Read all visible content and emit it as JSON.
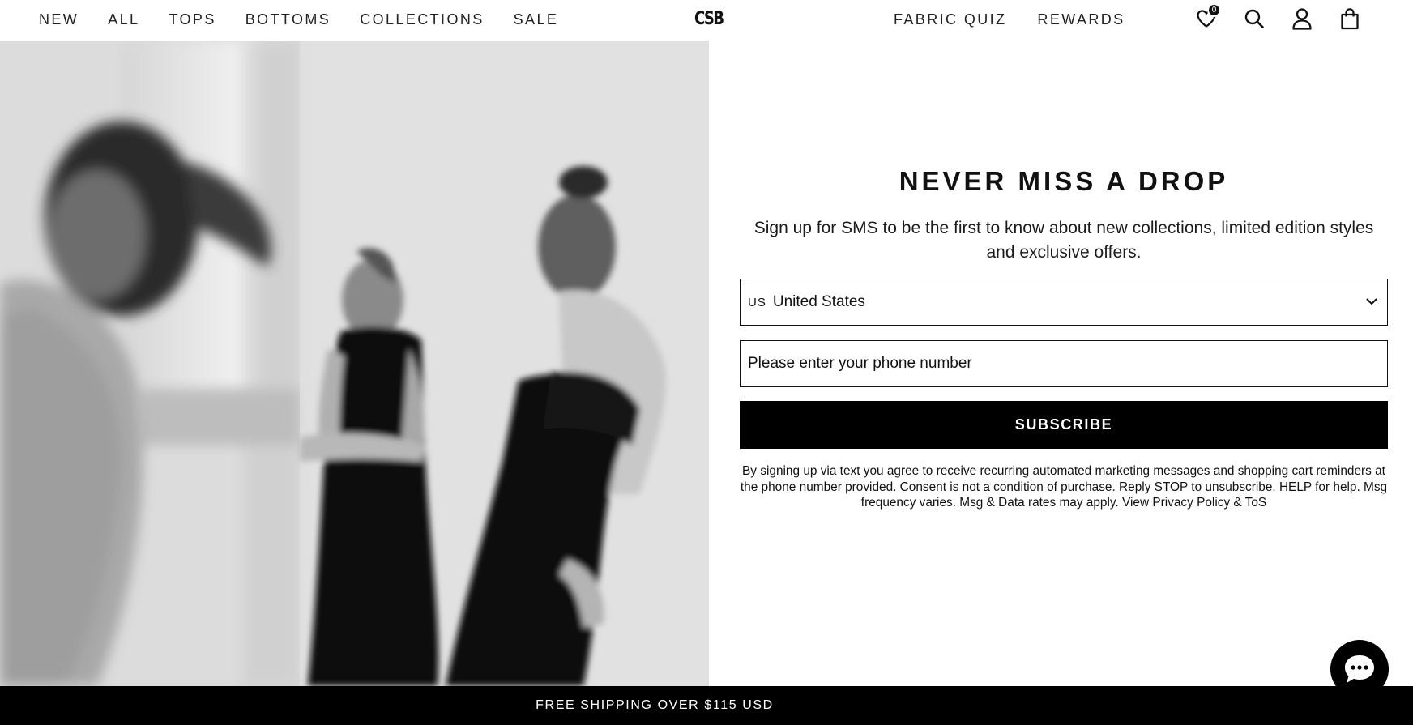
{
  "nav": {
    "left_links": [
      "NEW",
      "ALL",
      "TOPS",
      "BOTTOMS",
      "COLLECTIONS",
      "SALE"
    ],
    "logo": "CSB",
    "right_links": [
      "FABRIC QUIZ",
      "REWARDS"
    ],
    "wishlist_count": "0",
    "icons": [
      "heart-icon",
      "search-icon",
      "account-icon",
      "bag-icon"
    ]
  },
  "hero": {
    "image": "black-and-white blurred photo of three women"
  },
  "signup": {
    "headline": "NEVER MISS A DROP",
    "subtext": "Sign up for SMS to be the first to know about new collections, limited edition styles and exclusive offers.",
    "country_code": "US",
    "country_name": "United States",
    "phone_placeholder": "Please enter your phone number",
    "subscribe_label": "SUBSCRIBE",
    "disclaimer": "By signing up via text you agree to receive recurring automated marketing messages and shopping cart reminders at the phone number provided. Consent is not a condition of purchase. Reply STOP to unsubscribe. HELP for help. Msg frequency varies. Msg & Data rates may apply. View Privacy Policy & ToS"
  },
  "announcement": {
    "text": "FREE SHIPPING OVER $115 USD"
  },
  "colors": {
    "primary": "#000000",
    "background": "#ffffff"
  }
}
